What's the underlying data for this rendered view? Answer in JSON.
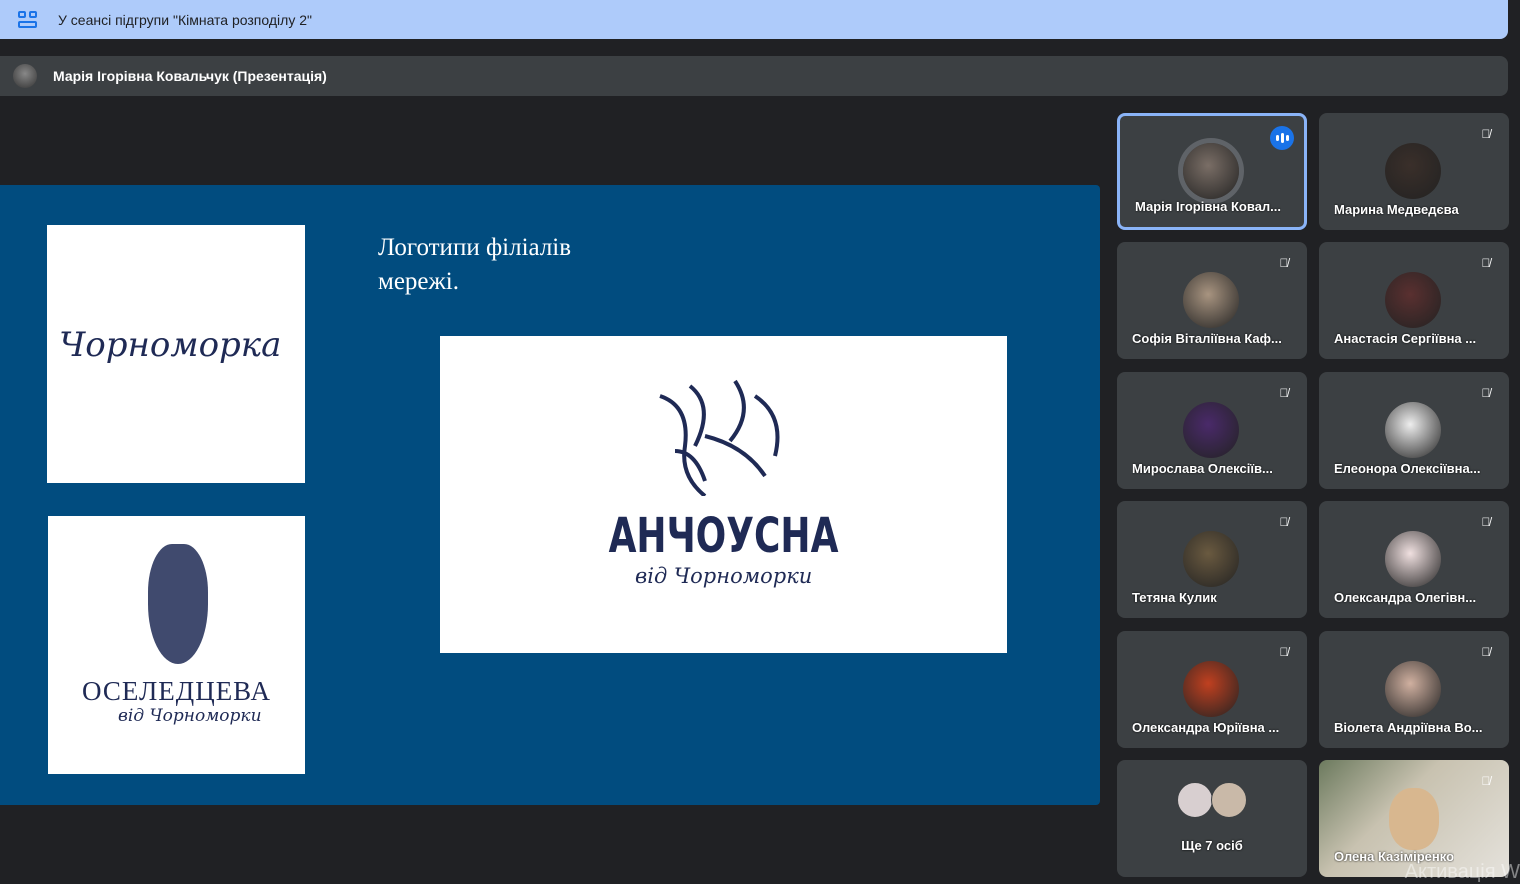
{
  "banner": {
    "icon": "breakout-rooms-icon",
    "text": "У сеансі підгрупи \"Кімната розподілу 2\""
  },
  "presenter_bar": {
    "text": "Марія Ігорівна Ковальчук (Презентація)"
  },
  "slide": {
    "title": "Логотипи філіалів мережі.",
    "logo1": "Чорноморка",
    "logo2_main": "ОСЕЛЕДЦЕВА",
    "logo2_sub": "від Чорноморки",
    "logo3_main": "АНЧОУСНА",
    "logo3_sub": "від Чорноморки"
  },
  "participants": [
    {
      "name": "Марія Ігорівна Ковал...",
      "state": "speaking"
    },
    {
      "name": "Марина Медведєва",
      "state": "muted"
    },
    {
      "name": "Софія Віталіївна Каф...",
      "state": "muted"
    },
    {
      "name": "Анастасія Сергіївна ...",
      "state": "muted"
    },
    {
      "name": "Мирослава Олексіїв...",
      "state": "muted"
    },
    {
      "name": "Елеонора Олексіївна...",
      "state": "muted"
    },
    {
      "name": "Тетяна Кулик",
      "state": "muted"
    },
    {
      "name": "Олександра Олегівн...",
      "state": "muted"
    },
    {
      "name": "Олександра Юріївна ...",
      "state": "muted"
    },
    {
      "name": "Віолета Андріївна Во...",
      "state": "muted"
    }
  ],
  "more": {
    "label": "Ще 7 осіб"
  },
  "video_tile": {
    "name": "Олена Казіміренко",
    "state": "muted"
  },
  "watermark": "Активація W"
}
